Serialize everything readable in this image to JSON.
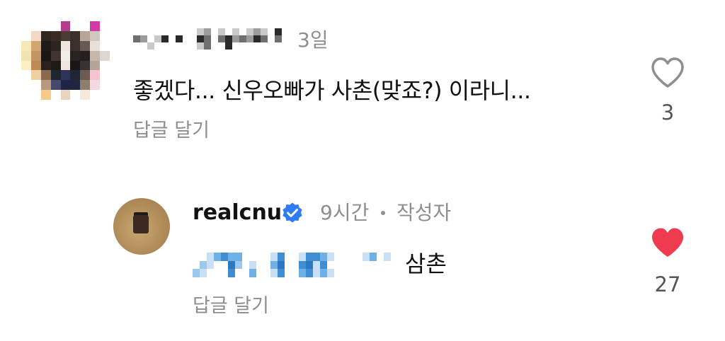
{
  "comments": [
    {
      "username": "",
      "time": "3일",
      "text": "좋겠다... 신우오빠가 사촌(맞죠?) 이라니...",
      "reply_label": "답글 달기",
      "likes": "3",
      "liked": false
    },
    {
      "username": "realcnu",
      "verified": true,
      "time": "9시간",
      "author_badge": "작성자",
      "text_visible": "삼촌",
      "reply_label": "답글 달기",
      "likes": "27",
      "liked": true
    }
  ],
  "colors": {
    "heart_liked": "#ef3b4f",
    "heart_outline": "#8e8e8e",
    "verified": "#2f7bf6",
    "secondary_text": "#8e8e8e"
  },
  "icons": [
    "heart-outline-icon",
    "heart-filled-icon",
    "verified-badge-icon"
  ]
}
